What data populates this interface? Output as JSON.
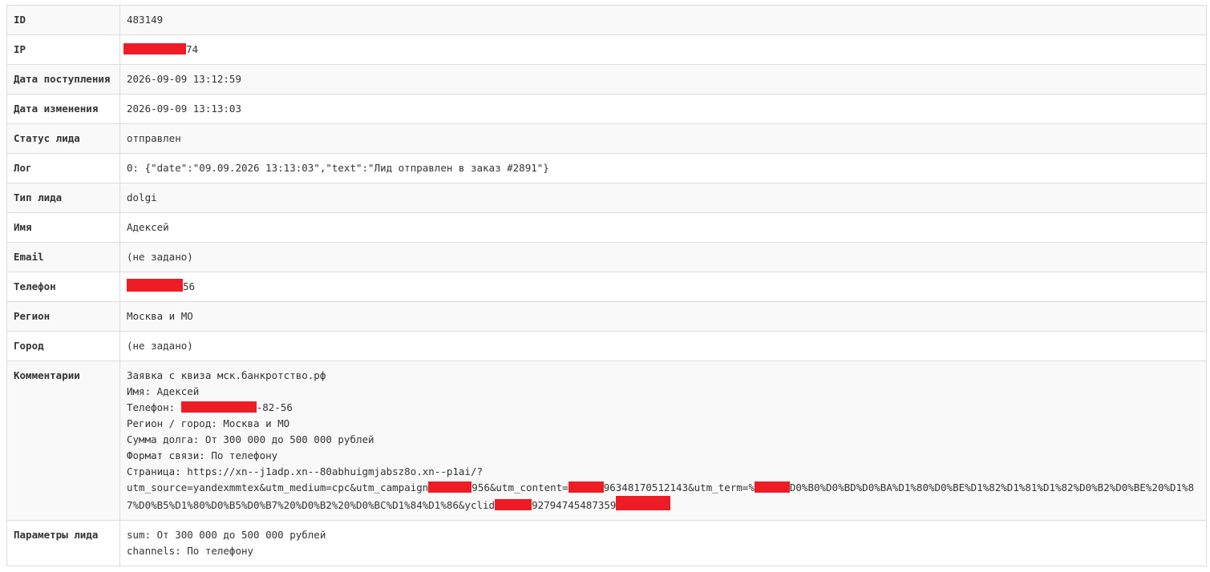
{
  "colors": {
    "redaction": "#ee1c25",
    "border": "#dddddd",
    "stripe": "#f9f9f9",
    "text": "#333333"
  },
  "rows": {
    "id": {
      "label": "ID",
      "value": "483149"
    },
    "ip": {
      "label": "IP",
      "value_suffix": "74"
    },
    "created": {
      "label": "Дата поступления",
      "value": "2026-09-09 13:12:59"
    },
    "updated": {
      "label": "Дата изменения",
      "value": "2026-09-09 13:13:03"
    },
    "status": {
      "label": "Статус лида",
      "value": "отправлен"
    },
    "log": {
      "label": "Лог",
      "value": "0: {\"date\":\"09.09.2026 13:13:03\",\"text\":\"Лид отправлен в заказ #2891\"}"
    },
    "type": {
      "label": "Тип лида",
      "value": "dolgi"
    },
    "name": {
      "label": "Имя",
      "value": "Адексей"
    },
    "email": {
      "label": "Email",
      "value": "(не задано)"
    },
    "phone": {
      "label": "Телефон",
      "value_suffix": "56"
    },
    "region": {
      "label": "Регион",
      "value": "Москва и МО"
    },
    "city": {
      "label": "Город",
      "value": "(не задано)"
    },
    "comments": {
      "label": "Комментарии",
      "line1": "Заявка с квиза мск.банкротство.рф",
      "line2": "Имя: Адексей",
      "line3_prefix": "Телефон: ",
      "line3_suffix": "-82-56",
      "line4": "Регион / город: Москва и МО",
      "line5": "Сумма долга: От 300 000 до 500 000 рублей",
      "line6": "Формат связи: По телефону",
      "line7": "Страница: https://xn--j1adp.xn--80abhuigmjabsz8o.xn--p1ai/?",
      "url_part1": "utm_source=yandexmmtex&utm_medium=cpc&utm_campaign",
      "url_part2": "956&utm_content=",
      "url_part3": "9634817051214З&utm_term=%",
      "url_part4": "D0%B0%D0%BD%D0%BA%D1%80%D0%BE%D1%82%D1%81%D1%82%D0%B2%D0%BE%20%D1%87%D0%B5%D1%80%D0%B5%D0%B7%20%D0%B2%20%D0%BC%D1%84%D1%86&yclid",
      "url_part5": "92794745487359"
    },
    "params": {
      "label": "Параметры лида",
      "line1": "sum: От 300 000 до 500 000 рублей",
      "line2": "channels: По телефону"
    }
  }
}
